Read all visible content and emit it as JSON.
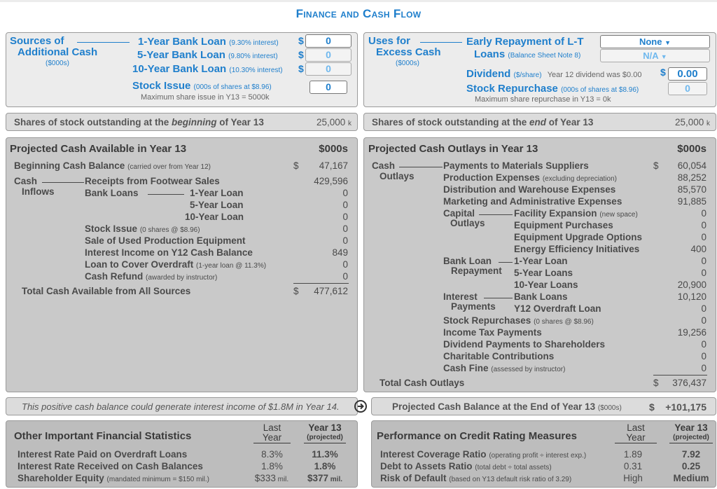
{
  "page_title": "Finance and Cash Flow",
  "sources": {
    "heading_line1": "Sources of",
    "heading_line2": "Additional Cash",
    "units": "($000s)",
    "loans": [
      {
        "label": "1-Year Bank Loan",
        "note": "(9.30% interest)",
        "currency": "$",
        "value": "0",
        "enabled": true
      },
      {
        "label": "5-Year Bank Loan",
        "note": "(9.80% interest)",
        "currency": "$",
        "value": "0",
        "enabled": false
      },
      {
        "label": "10-Year Bank Loan",
        "note": "(10.30% interest)",
        "currency": "$",
        "value": "0",
        "enabled": false
      }
    ],
    "stock_issue": {
      "label": "Stock Issue",
      "note": "(000s of shares at $8.96)",
      "value": "0",
      "max_note": "Maximum share issue in Y13 = 5000k"
    }
  },
  "uses": {
    "heading_line1": "Uses for",
    "heading_line2": "Excess Cash",
    "units": "($000s)",
    "early_repayment": {
      "label_line1": "Early Repayment of L-T",
      "label_line2": "Loans",
      "note": "(Balance Sheet Note 8)",
      "select1": "None",
      "select2": "N/A"
    },
    "dividend": {
      "label": "Dividend",
      "note": "($/share)",
      "info": "Year 12 dividend was $0.00",
      "currency": "$",
      "value": "0.00"
    },
    "stock_repurchase": {
      "label": "Stock Repurchase",
      "note": "(000s of shares at $8.96)",
      "value": "0",
      "max_note": "Maximum share repurchase in Y13 = 0k"
    }
  },
  "shares_begin": {
    "pre": "Shares of stock outstanding at the ",
    "em": "beginning",
    "post": " of Year 13",
    "value": "25,000",
    "unit": "k"
  },
  "shares_end": {
    "pre": "Shares of stock outstanding at the ",
    "em": "end",
    "post": " of Year 13",
    "value": "25,000",
    "unit": "k"
  },
  "cash_available": {
    "title": "Projected Cash Available in Year 13",
    "units": "$000s",
    "beginning": {
      "label": "Beginning Cash Balance",
      "note": "(carried over from Year 12)",
      "currency": "$",
      "value": "47,167"
    },
    "group_line1": "Cash",
    "group_line2": "Inflows",
    "receipts": {
      "label": "Receipts from Footwear Sales",
      "value": "429,596"
    },
    "bank_loans_label": "Bank Loans",
    "loans": [
      {
        "label": "1-Year Loan",
        "value": "0"
      },
      {
        "label": "5-Year Loan",
        "value": "0"
      },
      {
        "label": "10-Year Loan",
        "value": "0"
      }
    ],
    "others": [
      {
        "label": "Stock Issue",
        "note": "(0 shares @ $8.96)",
        "value": "0"
      },
      {
        "label": "Sale of Used Production Equipment",
        "note": "",
        "value": "0"
      },
      {
        "label": "Interest Income on Y12 Cash Balance",
        "note": "",
        "value": "849"
      },
      {
        "label": "Loan to Cover Overdraft",
        "note": "(1-year loan @ 11.3%)",
        "value": "0"
      },
      {
        "label": "Cash Refund",
        "note": "(awarded by instructor)",
        "value": "0"
      }
    ],
    "total": {
      "label": "Total Cash Available from All Sources",
      "currency": "$",
      "value": "477,612"
    }
  },
  "cash_outlays": {
    "title": "Projected Cash Outlays in Year 13",
    "units": "$000s",
    "group_line1": "Cash",
    "group_line2": "Outlays",
    "currency": "$",
    "main": [
      {
        "label": "Payments to Materials Suppliers",
        "note": "",
        "value": "60,054"
      },
      {
        "label": "Production Expenses",
        "note": "(excluding depreciation)",
        "value": "88,252"
      },
      {
        "label": "Distribution and Warehouse Expenses",
        "note": "",
        "value": "85,570"
      },
      {
        "label": "Marketing and Administrative Expenses",
        "note": "",
        "value": "91,885"
      }
    ],
    "capital": {
      "line1": "Capital",
      "line2": "Outlays",
      "items": [
        {
          "label": "Facility Expansion",
          "note": "(new space)",
          "value": "0"
        },
        {
          "label": "Equipment Purchases",
          "note": "",
          "value": "0"
        },
        {
          "label": "Equipment Upgrade Options",
          "note": "",
          "value": "0"
        },
        {
          "label": "Energy Efficiency Initiatives",
          "note": "",
          "value": "400"
        }
      ]
    },
    "repayment": {
      "line1": "Bank Loan",
      "line2": "Repayment",
      "items": [
        {
          "label": "1-Year Loan",
          "value": "0"
        },
        {
          "label": "5-Year Loans",
          "value": "0"
        },
        {
          "label": "10-Year Loans",
          "value": "20,900"
        }
      ]
    },
    "interest": {
      "line1": "Interest",
      "line2": "Payments",
      "items": [
        {
          "label": "Bank Loans",
          "value": "10,120"
        },
        {
          "label": "Y12 Overdraft Loan",
          "value": "0"
        }
      ]
    },
    "others": [
      {
        "label": "Stock Repurchases",
        "note": "(0 shares @ $8.96)",
        "value": "0"
      },
      {
        "label": "Income Tax Payments",
        "note": "",
        "value": "19,256"
      },
      {
        "label": "Dividend Payments to Shareholders",
        "note": "",
        "value": "0"
      },
      {
        "label": "Charitable Contributions",
        "note": "",
        "value": "0"
      },
      {
        "label": "Cash Fine",
        "note": "(assessed by instructor)",
        "value": "0"
      }
    ],
    "total": {
      "label": "Total Cash Outlays",
      "currency": "$",
      "value": "376,437"
    }
  },
  "interest_note": "This positive cash balance could generate interest income of $1.8M in Year 14.",
  "projected_balance": {
    "label": "Projected Cash Balance at the End of Year 13",
    "units": "($000s)",
    "currency": "$",
    "value": "+101,175"
  },
  "financial_stats": {
    "title": "Other Important Financial Statistics",
    "col_last_line1": "Last",
    "col_last_line2": "Year",
    "col_proj_line1": "Year 13",
    "col_proj_line2": "(projected)",
    "rows": [
      {
        "label": "Interest Rate Paid on Overdraft Loans",
        "note": "",
        "last": "8.3%",
        "last_unit": "",
        "proj": "11.3%",
        "proj_unit": ""
      },
      {
        "label": "Interest Rate Received on Cash Balances",
        "note": "",
        "last": "1.8%",
        "last_unit": "",
        "proj": "1.8%",
        "proj_unit": ""
      },
      {
        "label": "Shareholder Equity",
        "note": "(mandated minimum = $150 mil.)",
        "last": "$333",
        "last_unit": " mil.",
        "proj": "$377",
        "proj_unit": " mil."
      }
    ]
  },
  "credit_rating": {
    "title": "Performance on Credit Rating Measures",
    "col_last_line1": "Last",
    "col_last_line2": "Year",
    "col_proj_line1": "Year 13",
    "col_proj_line2": "(projected)",
    "rows": [
      {
        "label": "Interest Coverage Ratio",
        "note": "(operating profit ÷ interest exp.)",
        "last": "1.89",
        "proj": "7.92"
      },
      {
        "label": "Debt to Assets Ratio",
        "note": "(total debt ÷ total assets)",
        "last": "0.31",
        "proj": "0.25"
      },
      {
        "label": "Risk of Default",
        "note": "(based on Y13 default risk ratio of 3.29)",
        "last": "High",
        "proj": "Medium"
      }
    ]
  },
  "icons": {
    "arrow": "circle-arrow-right-icon",
    "dropdown": "caret-down-icon"
  }
}
